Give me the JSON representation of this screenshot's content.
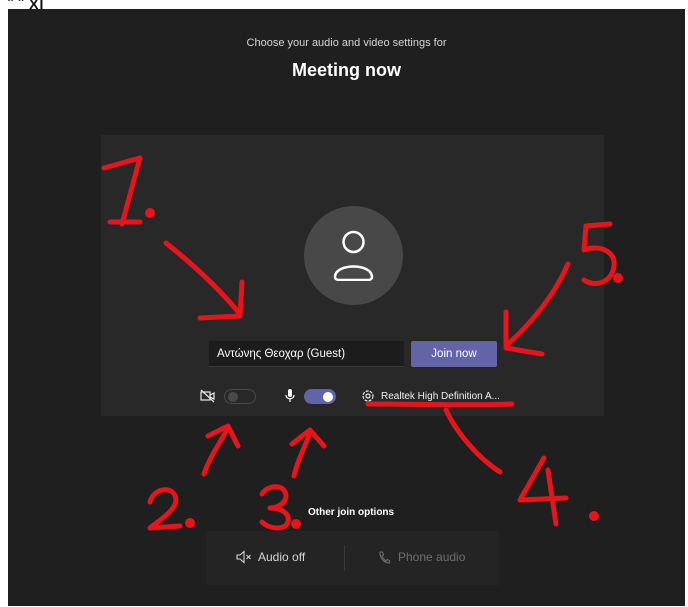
{
  "header": {
    "crop_text": "ˆ ˆ XI",
    "subtitle": "Choose your audio and video settings for",
    "title": "Meeting now"
  },
  "prejoin": {
    "name_value": "Αντώνης Θεοχαρ (Guest)",
    "join_label": "Join now",
    "camera_on": false,
    "mic_on": true,
    "device_label": "Realtek High Definition A..."
  },
  "footer": {
    "other_options": "Other join options",
    "audio_off": "Audio off",
    "phone_audio": "Phone audio"
  },
  "annotations": {
    "marker_1": "1.",
    "marker_2": "2.",
    "marker_3": "3.",
    "marker_4": "4.",
    "marker_5": "5."
  },
  "colors": {
    "background": "#201f1f",
    "panel": "#292828",
    "accent": "#6264a7",
    "annotation": "#e8141b"
  }
}
